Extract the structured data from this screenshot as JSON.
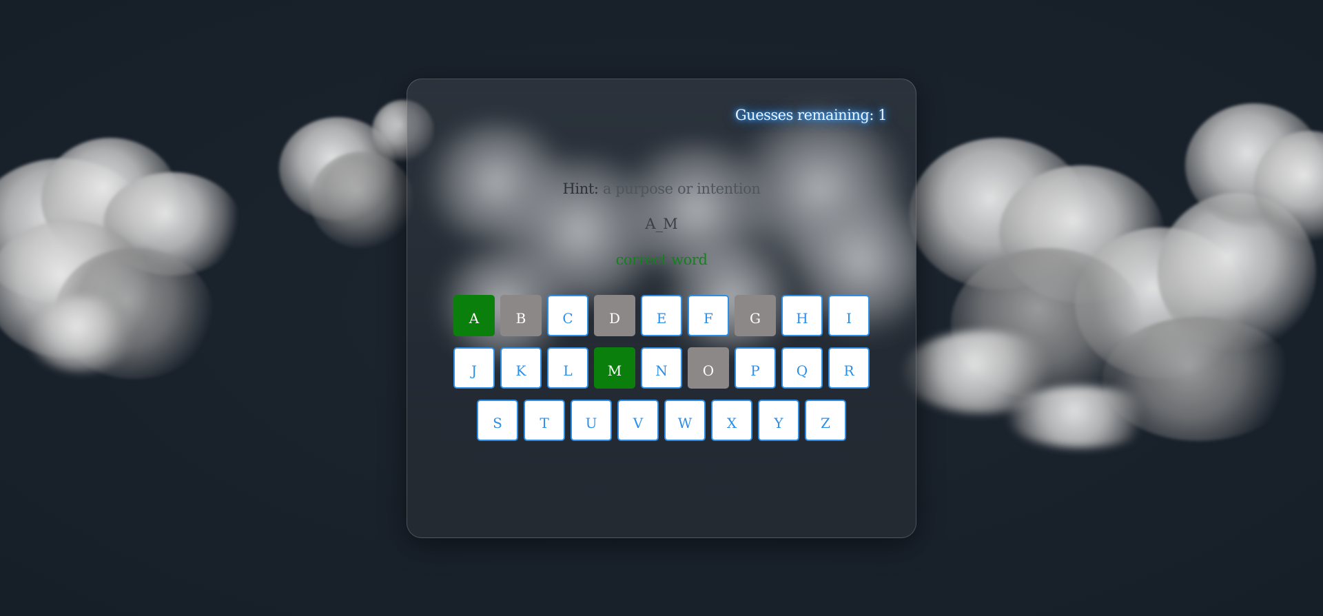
{
  "game": {
    "guesses_remaining_text": "Guesses remaining: 1",
    "hint_label": "Hint:",
    "hint_text": " a purpose or intention",
    "masked_word": "A_M",
    "status_message": "correct word"
  },
  "colors": {
    "correct": "#0b7f0b",
    "wrong": "#8c8888",
    "available_border": "#2b8ee8",
    "status_text": "#11831a",
    "glow": "#2f8fff"
  },
  "keyboard": {
    "rows": [
      [
        {
          "letter": "A",
          "state": "correct"
        },
        {
          "letter": "B",
          "state": "wrong"
        },
        {
          "letter": "C",
          "state": "available"
        },
        {
          "letter": "D",
          "state": "wrong"
        },
        {
          "letter": "E",
          "state": "available"
        },
        {
          "letter": "F",
          "state": "available"
        },
        {
          "letter": "G",
          "state": "wrong"
        },
        {
          "letter": "H",
          "state": "available"
        },
        {
          "letter": "I",
          "state": "available"
        }
      ],
      [
        {
          "letter": "J",
          "state": "available"
        },
        {
          "letter": "K",
          "state": "available"
        },
        {
          "letter": "L",
          "state": "available"
        },
        {
          "letter": "M",
          "state": "correct"
        },
        {
          "letter": "N",
          "state": "available"
        },
        {
          "letter": "O",
          "state": "wrong"
        },
        {
          "letter": "P",
          "state": "available"
        },
        {
          "letter": "Q",
          "state": "available"
        },
        {
          "letter": "R",
          "state": "available"
        }
      ],
      [
        {
          "letter": "S",
          "state": "available"
        },
        {
          "letter": "T",
          "state": "available"
        },
        {
          "letter": "U",
          "state": "available"
        },
        {
          "letter": "V",
          "state": "available"
        },
        {
          "letter": "W",
          "state": "available"
        },
        {
          "letter": "X",
          "state": "available"
        },
        {
          "letter": "Y",
          "state": "available"
        },
        {
          "letter": "Z",
          "state": "available"
        }
      ]
    ]
  }
}
